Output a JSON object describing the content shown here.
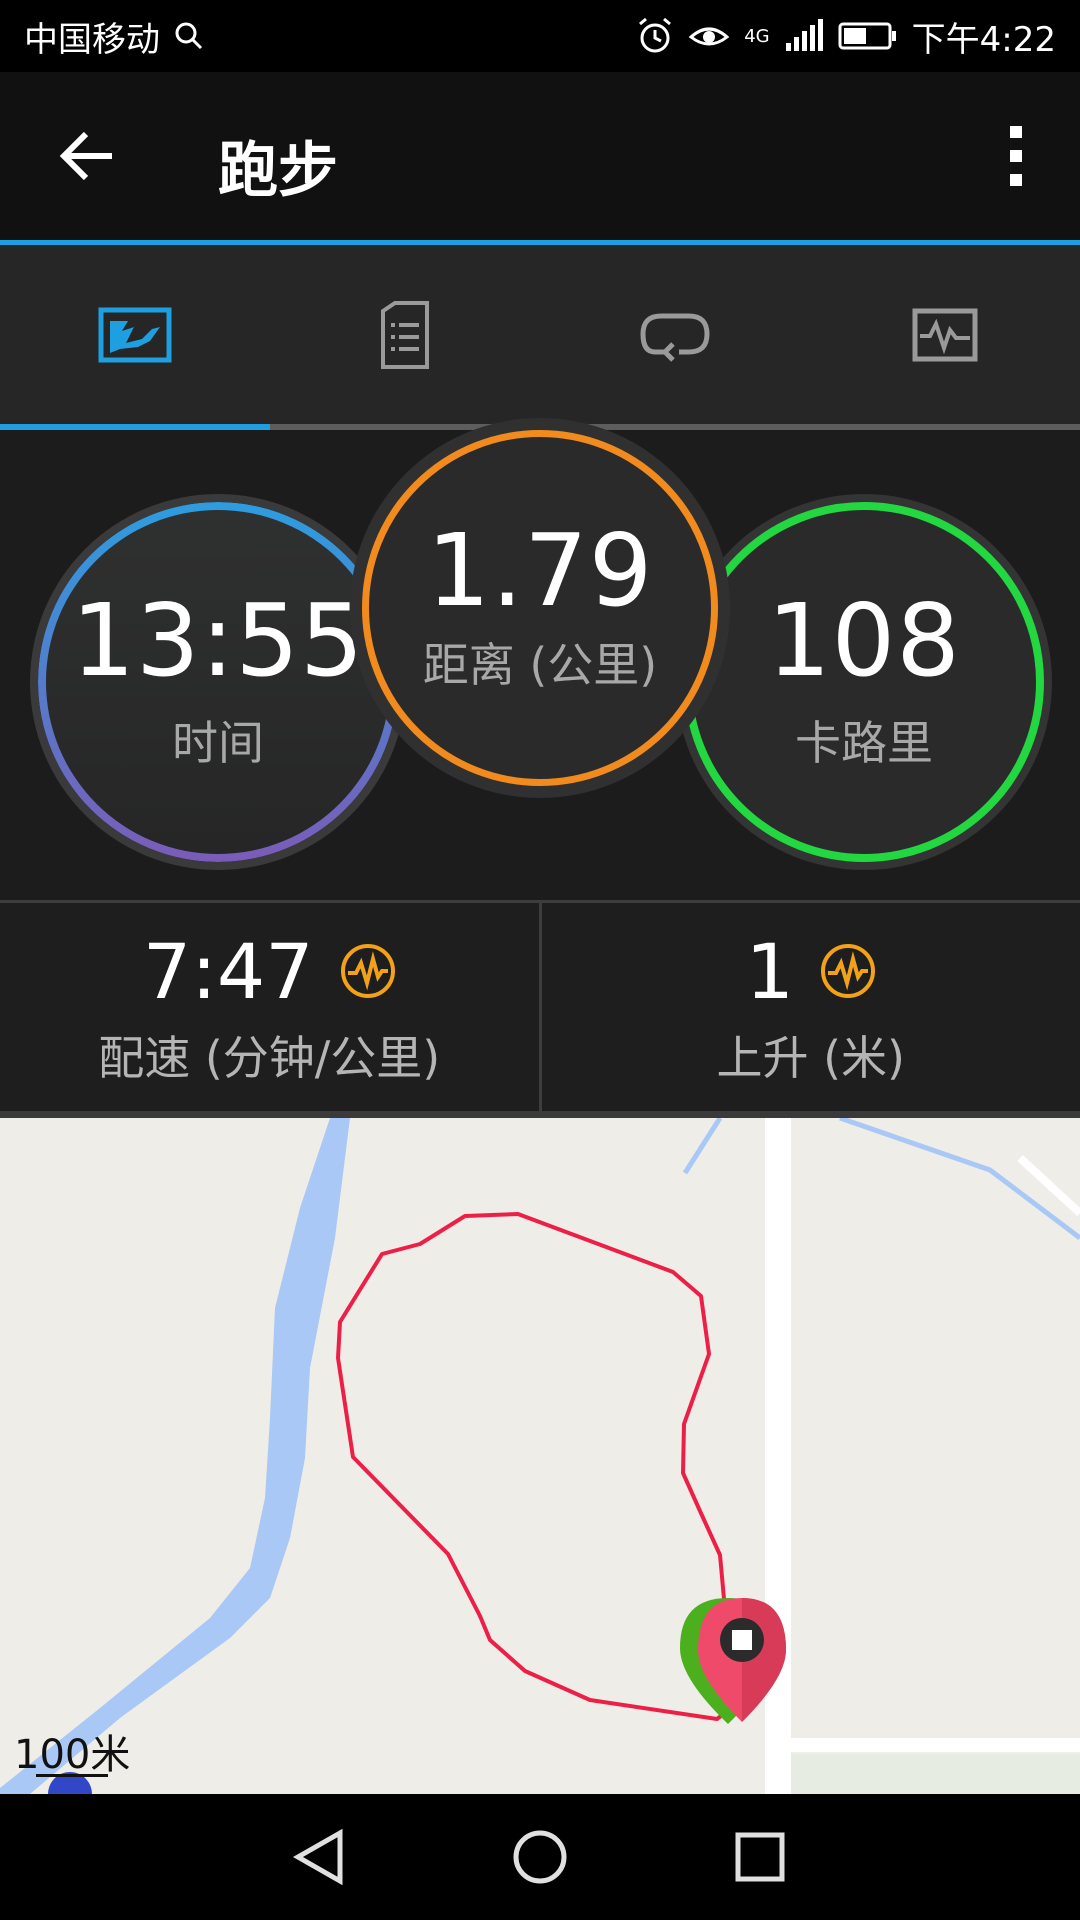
{
  "status_bar": {
    "carrier": "中国移动",
    "network": "4G",
    "time": "下午4:22",
    "icons": [
      "search-icon",
      "alarm-icon",
      "eye-icon",
      "signal-icon",
      "battery-icon"
    ]
  },
  "app_bar": {
    "title": "跑步",
    "back_icon": "arrow-left-icon",
    "menu_icon": "more-vertical-icon"
  },
  "tabs": [
    {
      "icon": "map-stats-icon",
      "active": true
    },
    {
      "icon": "document-list-icon",
      "active": false
    },
    {
      "icon": "lap-loop-icon",
      "active": false
    },
    {
      "icon": "chart-wave-icon",
      "active": false
    }
  ],
  "stats": {
    "time": {
      "value": "13:55",
      "label": "时间"
    },
    "distance": {
      "value": "1.79",
      "label": "距离 (公里)"
    },
    "calories": {
      "value": "108",
      "label": "卡路里"
    }
  },
  "details": {
    "pace": {
      "value": "7:47",
      "label": "配速 (分钟/公里)",
      "icon": "wave-icon"
    },
    "ascent": {
      "value": "1",
      "label": "上升 (米)",
      "icon": "wave-icon"
    }
  },
  "map": {
    "scale": "100米",
    "start_marker_color": "#4caf1e",
    "end_marker_color": "#ef4a6a",
    "route_color": "#ee1f47"
  },
  "colors": {
    "accent": "#1e9fe0",
    "time_ring_top": "#2d9ddf",
    "time_ring_bottom": "#7a5cb8",
    "distance_ring": "#f28b1e",
    "calories_ring": "#22d740",
    "wave_icon": "#f4a11a"
  }
}
